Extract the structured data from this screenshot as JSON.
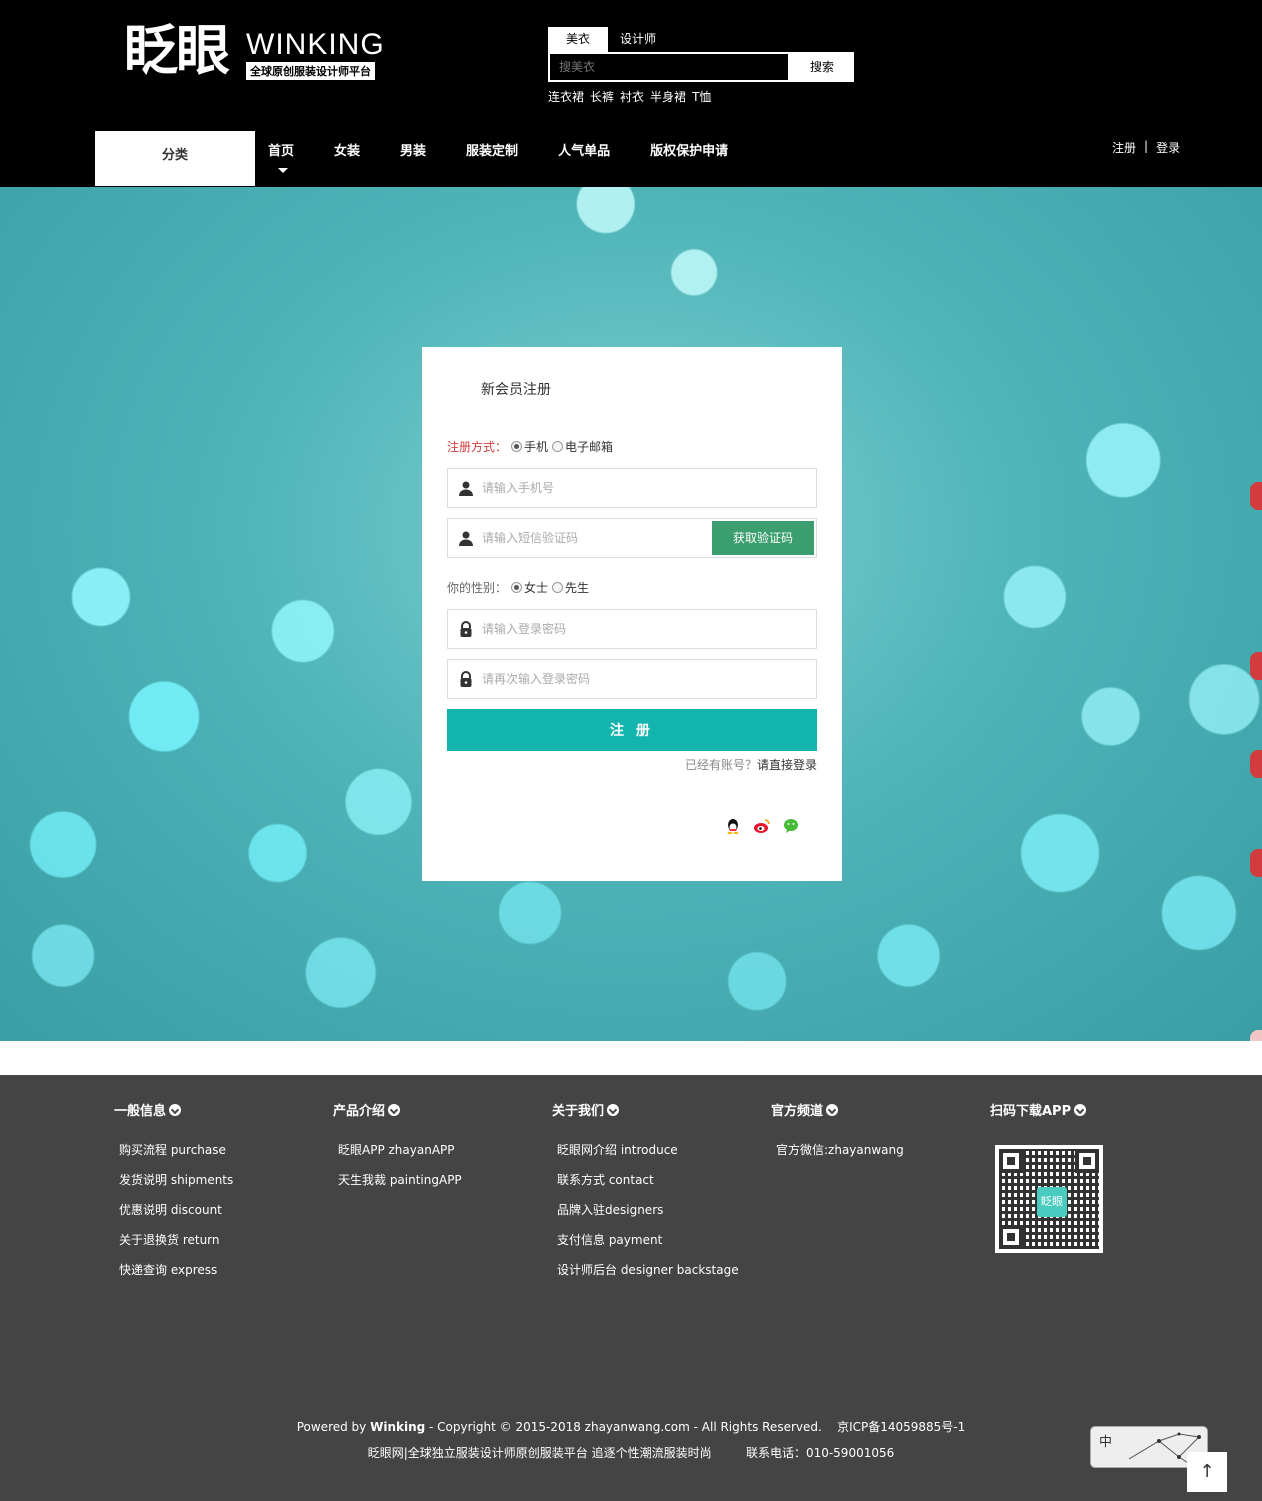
{
  "header": {
    "logo_cn": "眨眼",
    "logo_en": "WINKING",
    "logo_sub": "全球原创服装设计师平台",
    "search_tabs": [
      "美衣",
      "设计师"
    ],
    "search_placeholder": "搜美衣",
    "search_button": "搜索",
    "hot_words": [
      "连衣裙",
      "长裤",
      "衬衣",
      "半身裙",
      "T恤"
    ],
    "category": "分类",
    "nav": [
      "首页",
      "女装",
      "男装",
      "服装定制",
      "人气单品",
      "版权保护申请"
    ],
    "register": "注册",
    "separator": "|",
    "login": "登录"
  },
  "form": {
    "title": "新会员注册",
    "method_label": "注册方式：",
    "method_options": [
      "手机",
      "电子邮箱"
    ],
    "phone_placeholder": "请输入手机号",
    "sms_placeholder": "请输入短信验证码",
    "get_code": "获取验证码",
    "gender_label": "你的性别：",
    "gender_options": [
      "女士",
      "先生"
    ],
    "password_placeholder": "请输入登录密码",
    "password2_placeholder": "请再次输入登录密码",
    "submit": "注 册",
    "has_account": "已经有账号？",
    "login_link": "请直接登录",
    "social_icons": [
      "qq-icon",
      "weibo-icon",
      "wechat-icon"
    ],
    "colors": {
      "submit": "#13b4ad",
      "code_button": "#3a9e6e",
      "accent_label": "#d33c3c"
    }
  },
  "footer": {
    "columns": [
      {
        "title": "一般信息",
        "items": [
          "购买流程 purchase",
          "发货说明 shipments",
          "优惠说明 discount",
          "关于退换货 return",
          "快递查询 express"
        ]
      },
      {
        "title": "产品介绍",
        "items": [
          "眨眼APP zhayanAPP",
          "天生我裁 paintingAPP"
        ]
      },
      {
        "title": "关于我们",
        "items": [
          "眨眼网介绍 introduce",
          "联系方式 contact",
          "品牌入驻designers",
          "支付信息 payment",
          "设计师后台 designer backstage"
        ]
      },
      {
        "title": "官方频道",
        "items": [
          "官方微信:zhayanwang"
        ]
      },
      {
        "title": "扫码下载APP",
        "items": []
      }
    ],
    "qr_logo": "眨眼",
    "powered_prefix": "Powered by ",
    "powered_brand": "Winking",
    "powered_suffix": " - Copyright © 2015-2018 zhayanwang.com - All Rights Reserved.",
    "icp": "京ICP备14059885号-1",
    "slogan": "眨眼网|全球独立服装设计师原创服装平台 追逐个性潮流服装时尚",
    "phone": "联系电话：010-59001056"
  },
  "ime": {
    "label": "中"
  },
  "totop": "↑"
}
